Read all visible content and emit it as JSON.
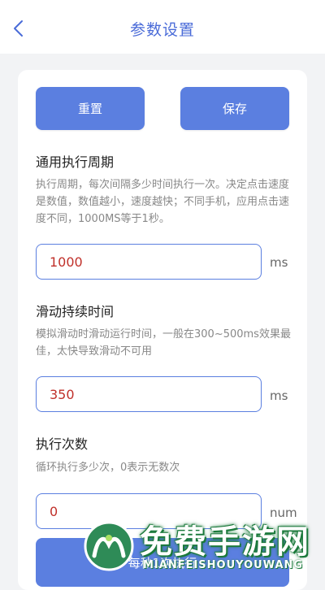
{
  "header": {
    "title": "参数设置",
    "back_icon": "chevron-left-icon"
  },
  "actions": {
    "reset_label": "重置",
    "save_label": "保存"
  },
  "sections": [
    {
      "title": "通用执行周期",
      "description": "执行周期，每次间隔多少时间执行一次。决定点击速度是数值，数值越小，速度越快；不同手机，应用点击速度不同，1000MS等于1秒。",
      "value": "1000",
      "unit": "ms"
    },
    {
      "title": "滑动持续时间",
      "description": "模拟滑动时滑动运行时间，一般在300~500ms效果最佳，太快导致滑动不可用",
      "value": "350",
      "unit": "ms"
    },
    {
      "title": "执行次数",
      "description": "循环执行多少次，0表示无数次",
      "value": "0",
      "unit": "num"
    }
  ],
  "bottom_button": {
    "label": "每秒1次执行"
  },
  "watermark": {
    "main": "免费手游网",
    "sub": "MIANFEISHOUYOUWANG"
  },
  "colors": {
    "accent": "#5b7fe0",
    "title": "#4a6bd8",
    "value_text": "#c0302a",
    "background": "#f2f3f5"
  }
}
